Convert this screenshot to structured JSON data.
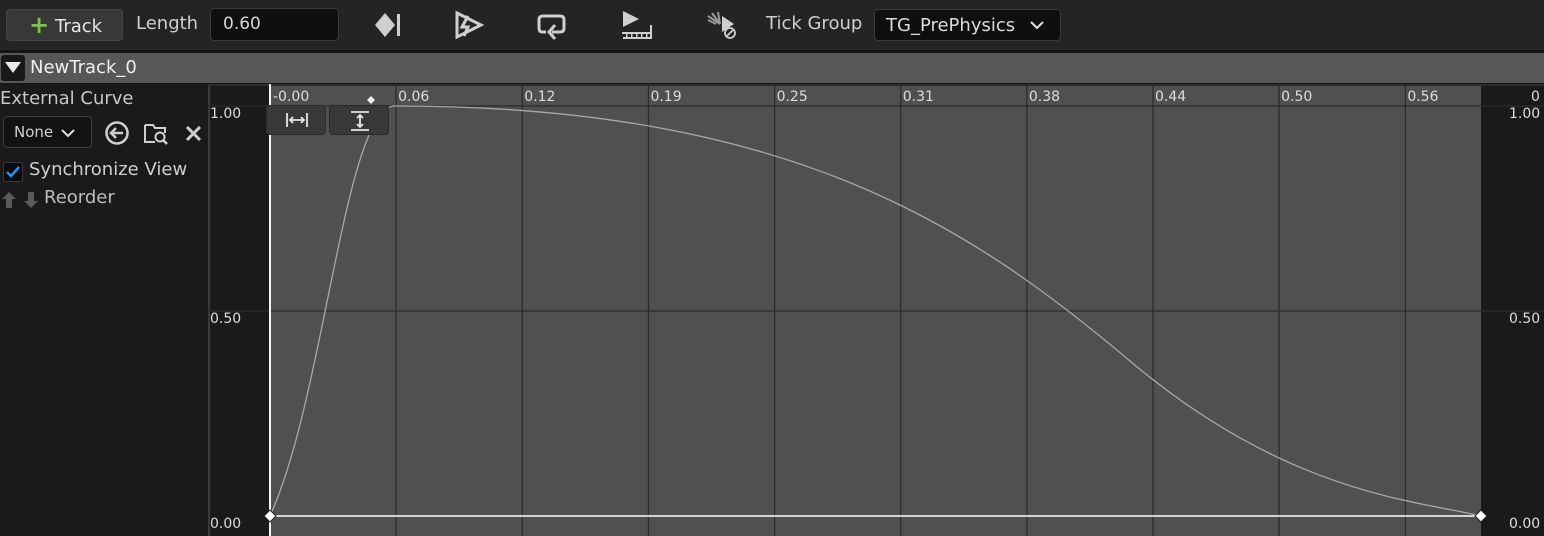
{
  "toolbar": {
    "track_button_label": "Track",
    "length_label": "Length",
    "length_value": "0.60",
    "tick_group_label": "Tick Group",
    "tick_group_value": "TG_PrePhysics",
    "icons": [
      "add-key-icon",
      "autoplay-icon",
      "loop-icon",
      "use-last-keyframe-icon",
      "ignore-time-dilation-icon"
    ]
  },
  "track": {
    "name": "NewTrack_0",
    "external_curve_label": "External Curve",
    "external_curve_value": "None",
    "synchronize_view_label": "Synchronize View",
    "synchronize_view_checked": true,
    "reorder_label": "Reorder"
  },
  "curve_editor": {
    "x_ticks": [
      "-0.00",
      "0.06",
      "0.12",
      "0.19",
      "0.25",
      "0.31",
      "0.38",
      "0.44",
      "0.50",
      "0.56"
    ],
    "x_ticks_partial": "0",
    "y_ticks_left": [
      "1.00",
      "0.50",
      "0.00"
    ],
    "y_ticks_right": [
      "1.00",
      "0.50",
      "0.00"
    ],
    "keys": [
      {
        "time": 0.0,
        "value": 0.0
      },
      {
        "time": 0.6,
        "value": 0.0
      }
    ],
    "curve_color": "#a8a8a8",
    "grid_color": "#2a2a2a",
    "active_range_color": "#505050"
  }
}
